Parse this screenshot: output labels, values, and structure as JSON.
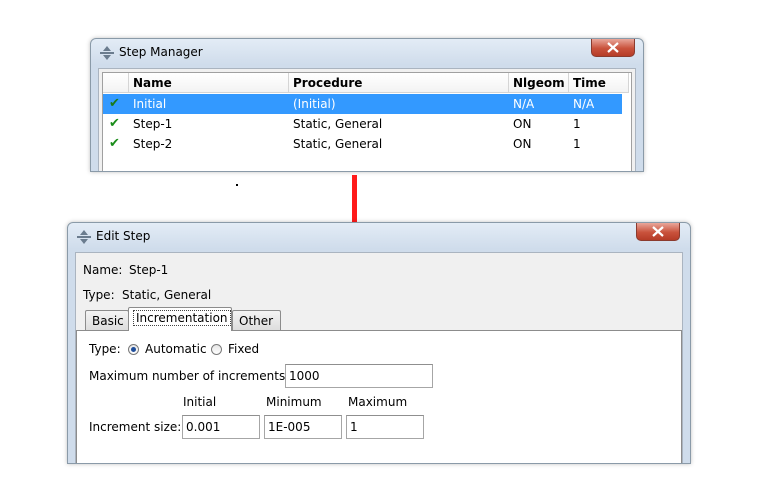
{
  "step_manager": {
    "title": "Step Manager",
    "columns": [
      "Name",
      "Procedure",
      "Nlgeom",
      "Time"
    ],
    "rows": [
      {
        "check": "✔",
        "name": "Initial",
        "procedure": "(Initial)",
        "nlgeom": "N/A",
        "time": "N/A",
        "selected": true
      },
      {
        "check": "✔",
        "name": "Step-1",
        "procedure": "Static, General",
        "nlgeom": "ON",
        "time": "1",
        "selected": false
      },
      {
        "check": "✔",
        "name": "Step-2",
        "procedure": "Static, General",
        "nlgeom": "ON",
        "time": "1",
        "selected": false
      }
    ]
  },
  "edit_step": {
    "title": "Edit Step",
    "name_label": "Name:",
    "name_value": "Step-1",
    "type_label": "Type:",
    "type_value": "Static, General",
    "tabs": [
      "Basic",
      "Incrementation",
      "Other"
    ],
    "active_tab": "Incrementation",
    "incrementation": {
      "type_label": "Type:",
      "type_options": [
        "Automatic",
        "Fixed"
      ],
      "selected_type": "Automatic",
      "max_increments_label": "Maximum number of increments:",
      "max_increments_value": "1000",
      "increment_headers": [
        "Initial",
        "Minimum",
        "Maximum"
      ],
      "increment_size_label": "Increment size:",
      "initial_value": "0.001",
      "minimum_value": "1E-005",
      "maximum_value": "1"
    }
  },
  "colors": {
    "selection": "#3399ff",
    "checkmark": "#1a8c1a",
    "arrow": "#ff1a1a",
    "close_button": "#c9523c"
  },
  "icons": {
    "window_icon": "abaqus-window-icon",
    "close": "close-icon",
    "check": "checkmark-icon",
    "arrow": "down-arrow-icon"
  }
}
